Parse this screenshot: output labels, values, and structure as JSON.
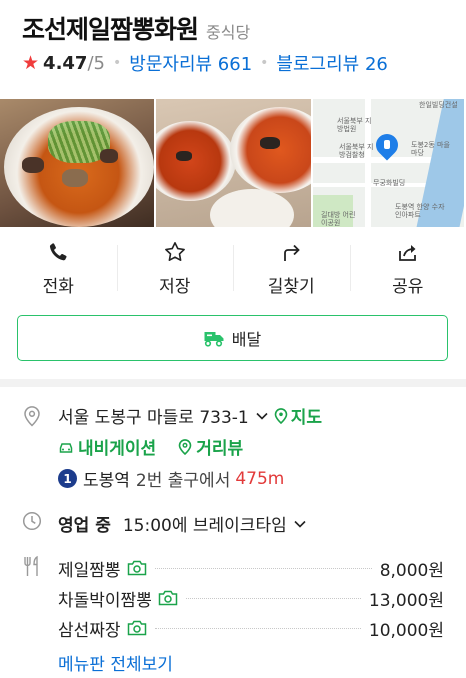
{
  "place": {
    "name": "조선제일짬뽕화원",
    "category": "중식당",
    "rating": "4.47",
    "rating_max": "/5",
    "visitor_reviews": "방문자리뷰 661",
    "blog_reviews": "블로그리뷰 26"
  },
  "photos": [
    {
      "icon": "jjamppong-bowl-photo"
    },
    {
      "icon": "jjamppong-bowls-photo"
    },
    {
      "icon": "map-thumbnail",
      "labels": [
        "서울북부 지방법원",
        "서울북부 지방검찰청",
        "도봉2동 마을마당",
        "무궁화빌딩",
        "도봉역 한양 수자인아파트",
        "길대방 어린이공원",
        "한일빌딩건설"
      ]
    }
  ],
  "actions": [
    {
      "label": "전화",
      "icon": "phone-icon"
    },
    {
      "label": "저장",
      "icon": "star-outline-icon"
    },
    {
      "label": "길찾기",
      "icon": "directions-icon"
    },
    {
      "label": "공유",
      "icon": "share-icon"
    }
  ],
  "delivery": {
    "label": "배달",
    "icon": "delivery-truck-icon",
    "accent": "#2ac26b"
  },
  "info": {
    "address": "서울 도봉구 마들로 733-1",
    "map_link": "지도",
    "navigation": "내비게이션",
    "street_view": "거리뷰",
    "subway_line": "1",
    "subway_line_color": "#1c3c8c",
    "station": "도봉역",
    "exit_text": "2번 출구에서",
    "distance": "475m",
    "hours_status": "영업 중",
    "hours_detail": "15:00에 브레이크타임"
  },
  "menu": {
    "items": [
      {
        "name": "제일짬뽕",
        "price": "8,000원"
      },
      {
        "name": "차돌박이짬뽕",
        "price": "13,000원"
      },
      {
        "name": "삼선짜장",
        "price": "10,000원"
      }
    ],
    "view_all": "메뉴판 전체보기"
  },
  "colors": {
    "link_blue": "#0a6fd6",
    "green": "#1aa34a",
    "star_red": "#f03c3c",
    "distance_red": "#e23a3a"
  }
}
